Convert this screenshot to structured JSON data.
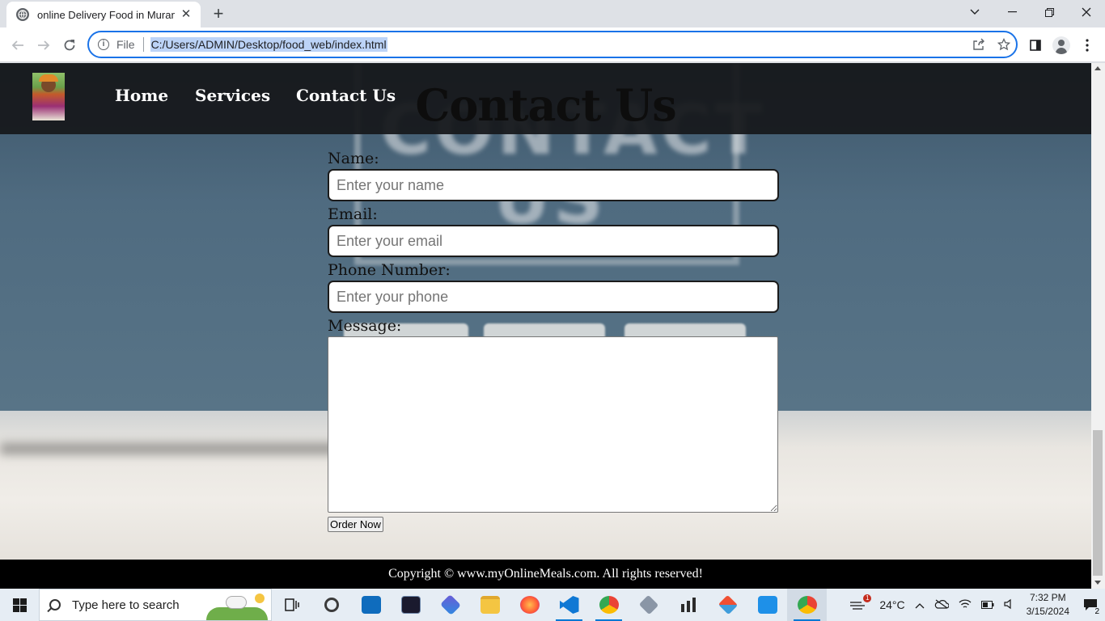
{
  "browser": {
    "tab_title": "online Delivery Food in Murang'a",
    "new_tab_label": "+",
    "file_label": "File",
    "url": "C:/Users/ADMIN/Desktop/food_web/index.html"
  },
  "site": {
    "nav": [
      "Home",
      "Services",
      "Contact Us"
    ],
    "heading": "Contact Us",
    "form": {
      "name_label": "Name:",
      "name_placeholder": "Enter your name",
      "email_label": "Email:",
      "email_placeholder": "Enter your email",
      "phone_label": "Phone Number:",
      "phone_placeholder": "Enter your phone",
      "message_label": "Message:",
      "submit_label": "Order Now"
    },
    "footer": "Copyright © www.myOnlineMeals.com. All rights reserved!",
    "background_sign_text": "CONTACT US"
  },
  "taskbar": {
    "search_placeholder": "Type here to search",
    "weather": "24°C",
    "weather_badge": "1",
    "time": "7:32 PM",
    "date": "3/15/2024",
    "notifications": "2",
    "apps": [
      "task-view",
      "copilot",
      "mail",
      "photos",
      "edge-dev",
      "file-explorer",
      "firefox",
      "vscode",
      "chrome-profile",
      "app-cube",
      "app-bars",
      "git",
      "azure-studio",
      "chrome"
    ]
  },
  "colors": {
    "accent": "#1a73e8",
    "header_bg": "#16181c",
    "footer_bg": "#000000"
  }
}
